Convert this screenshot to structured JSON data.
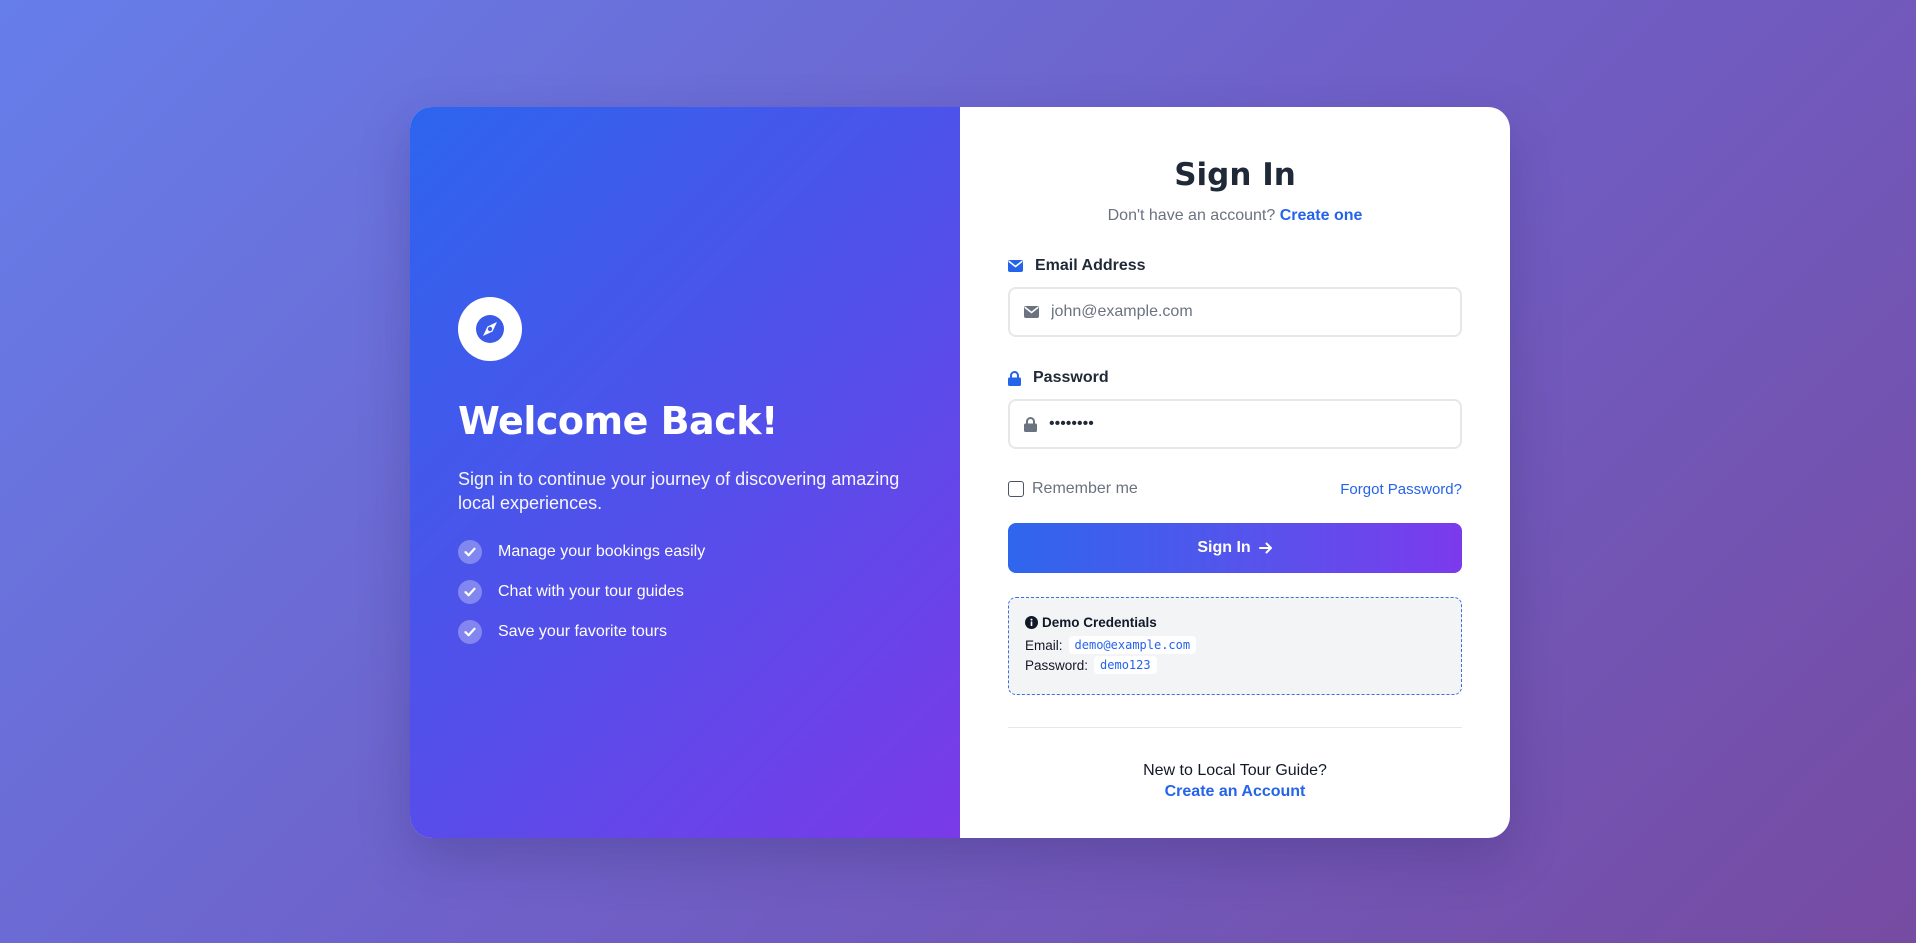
{
  "colors": {
    "accent": "#2563eb",
    "accent_purple": "#7c3aed",
    "text_dark": "#1f2937",
    "text_muted": "#6b7280"
  },
  "hero": {
    "logo_icon": "compass-icon",
    "title": "Welcome Back!",
    "tagline": "Sign in to continue your journey of discovering amazing local experiences.",
    "features": [
      {
        "icon": "check-icon",
        "label": "Manage your bookings easily"
      },
      {
        "icon": "check-icon",
        "label": "Chat with your tour guides"
      },
      {
        "icon": "check-icon",
        "label": "Save your favorite tours"
      }
    ]
  },
  "form": {
    "title": "Sign In",
    "subtitle_text": "Don't have an account?",
    "subtitle_link": "Create one",
    "email": {
      "label": "Email Address",
      "icon": "envelope-icon",
      "placeholder": "john@example.com",
      "value": ""
    },
    "password": {
      "label": "Password",
      "icon": "lock-icon",
      "value": "••••••••"
    },
    "remember_label": "Remember me",
    "forgot_label": "Forgot Password?",
    "submit_label": "Sign In",
    "submit_icon": "arrow-right-icon"
  },
  "demo": {
    "icon": "info-circle-icon",
    "title": "Demo Credentials",
    "email_label": "Email:",
    "email_value": "demo@example.com",
    "password_label": "Password:",
    "password_value": "demo123"
  },
  "footer": {
    "prompt": "New to Local Tour Guide?",
    "link": "Create an Account"
  }
}
